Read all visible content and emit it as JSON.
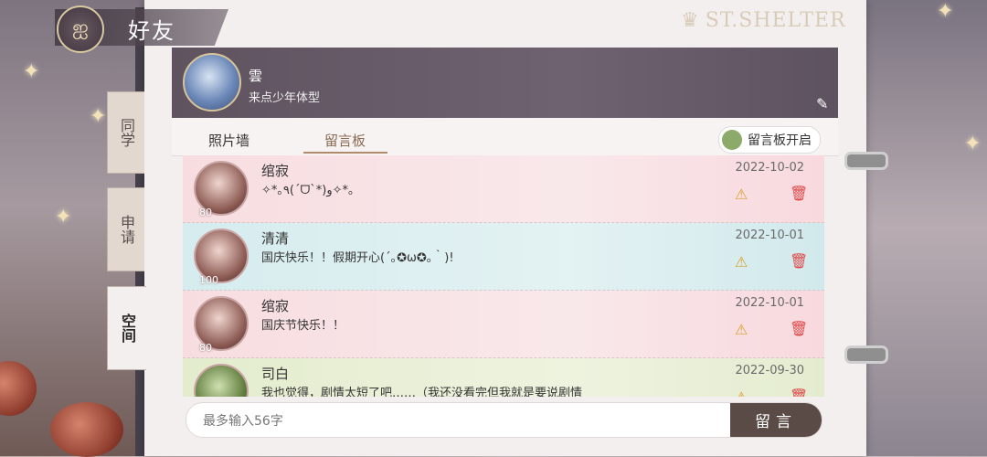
{
  "header": {
    "title": "好友",
    "brand": "ST.SHELTER"
  },
  "side_tabs": [
    {
      "label": "同学",
      "active": false
    },
    {
      "label": "申请",
      "active": false
    },
    {
      "label": "空间",
      "active": true
    }
  ],
  "profile": {
    "name": "雲",
    "signature": "来点少年体型"
  },
  "tabs": [
    {
      "label": "照片墙",
      "active": false
    },
    {
      "label": "留言板",
      "active": true
    }
  ],
  "toggle": {
    "label": "留言板开启"
  },
  "messages": [
    {
      "name": "绾寂",
      "text": "✧*｡٩(ˊᗜˋ*)و✧*｡",
      "date": "2022-10-02",
      "level": "80",
      "theme": "pink"
    },
    {
      "name": "清清",
      "text": "国庆快乐！！假期开心(´｡✪ω✪｡｀)!",
      "date": "2022-10-01",
      "level": "100",
      "theme": "blue"
    },
    {
      "name": "绾寂",
      "text": "国庆节快乐！！",
      "date": "2022-10-01",
      "level": "80",
      "theme": "pink"
    },
    {
      "name": "司白",
      "text": "我也觉得，剧情太短了吧……（我还没看完但我就是要说剧情",
      "date": "2022-09-30",
      "level": "",
      "theme": "green"
    }
  ],
  "composer": {
    "placeholder": "最多输入56字",
    "value": "",
    "send_label": "留言"
  },
  "colors": {
    "accent": "#8a6b52",
    "profile_bar": "#6f6270",
    "send_button": "#5a4b46",
    "warning": "#d9a22c",
    "delete": "#e04848"
  },
  "icons": [
    "butterfly-icon",
    "edit-icon",
    "warning-icon",
    "trash-icon"
  ]
}
